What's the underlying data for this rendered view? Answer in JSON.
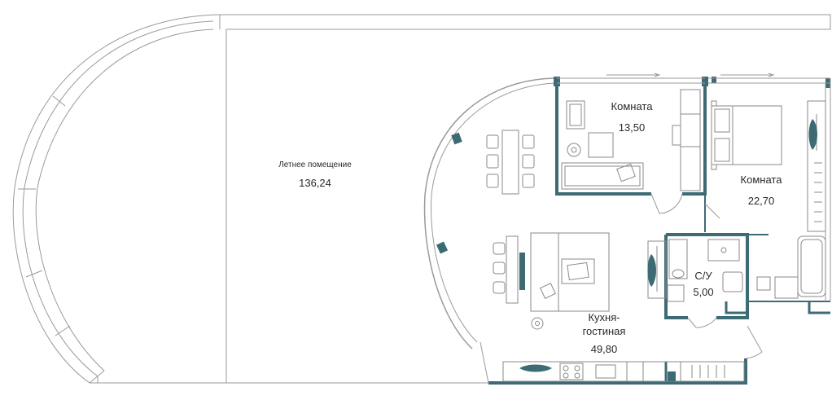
{
  "plan": {
    "colors": {
      "wall": "#3d6b74",
      "line": "#9a9a9a",
      "furniture": "#8a8a8a",
      "text": "#2a2a2a",
      "background": "#ffffff"
    },
    "rooms": [
      {
        "id": "summer",
        "name": "Летнее помещение",
        "area": "136,24"
      },
      {
        "id": "room1",
        "name": "Комната",
        "area": "13,50"
      },
      {
        "id": "room2",
        "name": "Комната",
        "area": "22,70"
      },
      {
        "id": "wc",
        "name": "С/У",
        "area": "5,00"
      },
      {
        "id": "kitchen",
        "name_line1": "Кухня-",
        "name_line2": "гостиная",
        "area": "49,80"
      }
    ]
  }
}
